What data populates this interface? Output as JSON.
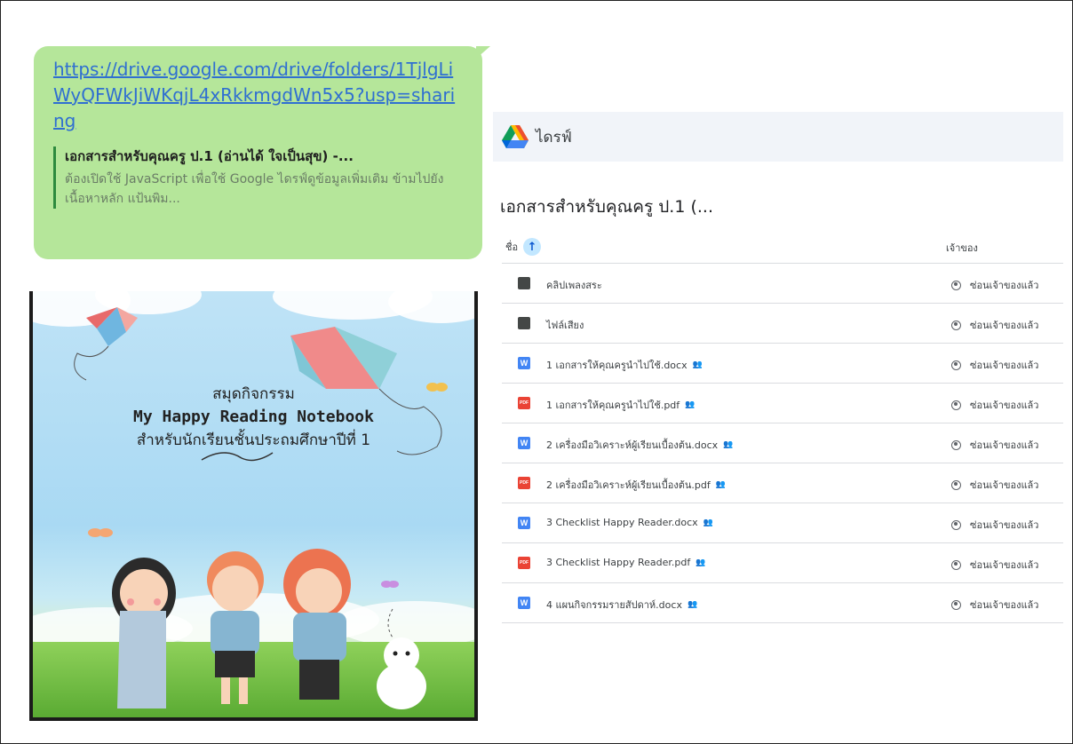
{
  "chat": {
    "link_text": "https://drive.google.com/drive/folders/1TjlgLiWyQFWkJiWKqjL4xRkkmgdWn5x5?usp=sharing",
    "preview_title": "เอกสารสำหรับคุณครู ป.1 (อ่านได้ ใจเป็นสุข) -...",
    "preview_description": "ต้องเปิดใช้ JavaScript เพื่อใช้ Google ไดรฟ์ดูข้อมูลเพิ่มเติม ข้ามไปยังเนื้อหาหลัก แป้นพิม..."
  },
  "cover": {
    "line1": "สมุดกิจกรรม",
    "line2": "My Happy Reading Notebook",
    "line3": "สำหรับนักเรียนชั้นประถมศึกษาปีที่ 1"
  },
  "drive": {
    "app_name": "ไดรฟ์",
    "folder_title": "เอกสารสำหรับคุณครู ป.1 (...",
    "col_name": "ชื่อ",
    "col_owner": "เจ้าของ",
    "files": [
      {
        "name": "คลิปเพลงสระ",
        "type": "folder",
        "shared": false,
        "owner": "ซ่อนเจ้าของแล้ว"
      },
      {
        "name": "ไฟล์เสียง",
        "type": "folder",
        "shared": false,
        "owner": "ซ่อนเจ้าของแล้ว"
      },
      {
        "name": "1 เอกสารให้คุณครูนำไปใช้.docx",
        "type": "word",
        "shared": true,
        "owner": "ซ่อนเจ้าของแล้ว"
      },
      {
        "name": "1 เอกสารให้คุณครูนำไปใช้.pdf",
        "type": "pdf",
        "shared": true,
        "owner": "ซ่อนเจ้าของแล้ว"
      },
      {
        "name": "2 เครื่องมือวิเคราะห์ผู้เรียนเบื้องต้น.docx",
        "type": "word",
        "shared": true,
        "owner": "ซ่อนเจ้าของแล้ว"
      },
      {
        "name": "2 เครื่องมือวิเคราะห์ผู้เรียนเบื้องต้น.pdf",
        "type": "pdf",
        "shared": true,
        "owner": "ซ่อนเจ้าของแล้ว"
      },
      {
        "name": "3 Checklist Happy Reader.docx",
        "type": "word",
        "shared": true,
        "owner": "ซ่อนเจ้าของแล้ว"
      },
      {
        "name": "3 Checklist Happy Reader.pdf",
        "type": "pdf",
        "shared": true,
        "owner": "ซ่อนเจ้าของแล้ว"
      },
      {
        "name": "4 แผนกิจกรรมรายสัปดาห์.docx",
        "type": "word",
        "shared": true,
        "owner": "ซ่อนเจ้าของแล้ว"
      }
    ]
  }
}
